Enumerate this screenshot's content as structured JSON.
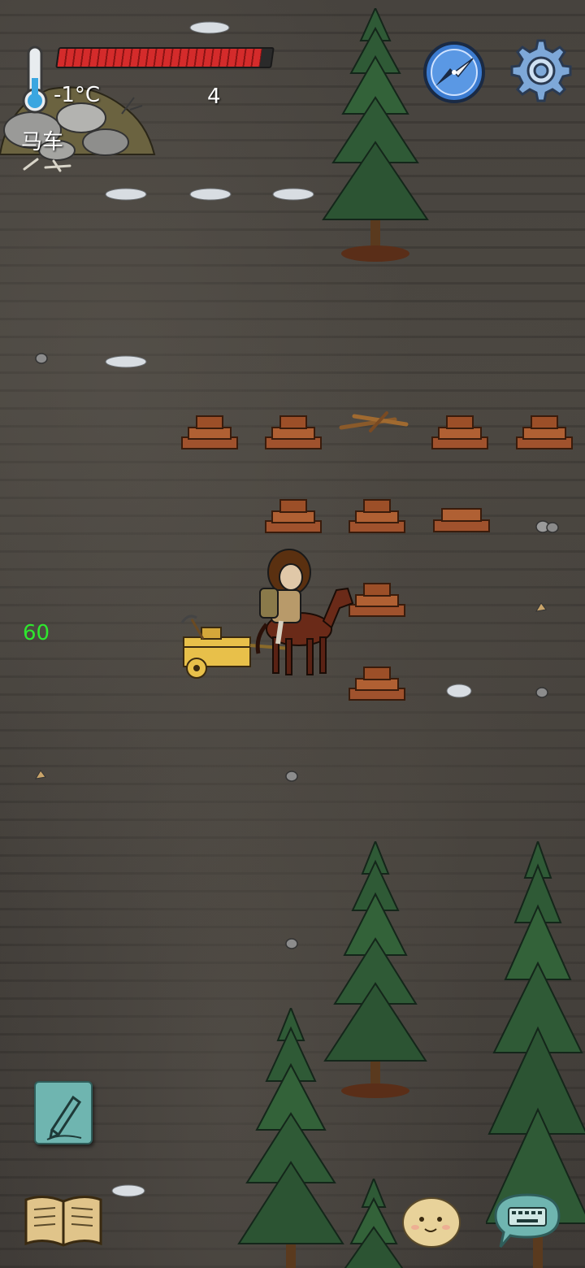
{
  "hud": {
    "temperature": "-1°C",
    "count": "4",
    "location_label": "马车",
    "health_fraction": 0.95
  },
  "world": {
    "fps_counter": "60"
  },
  "icons": {
    "thermometer": "thermometer-icon",
    "compass": "compass-icon",
    "settings": "gear-icon",
    "pencil": "pencil-icon",
    "book": "book-icon",
    "emote": "emote-face-icon",
    "keyboard": "keyboard-icon"
  },
  "colors": {
    "health": "#d42b2b",
    "fps": "#2ee82e",
    "ground": "#47433e",
    "tree": "#2f5a36"
  }
}
